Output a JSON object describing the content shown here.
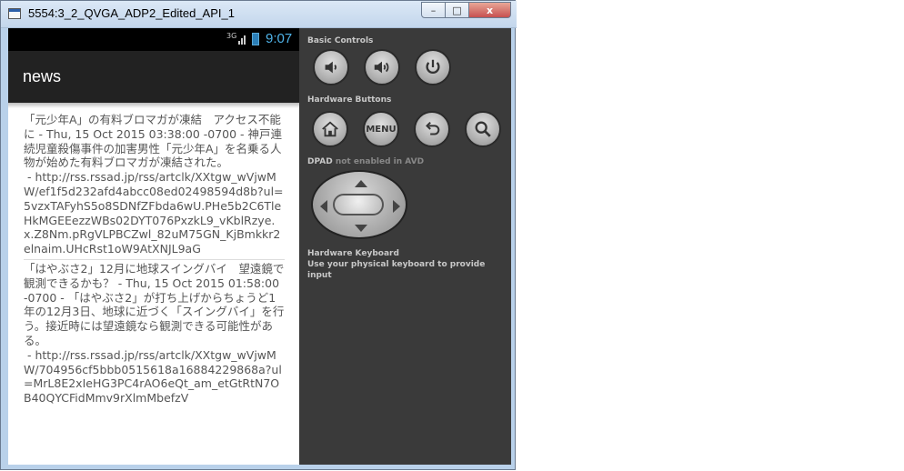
{
  "window": {
    "title": "5554:3_2_QVGA_ADP2_Edited_API_1",
    "minimize": "–",
    "maximize": "□",
    "close": "x"
  },
  "status_bar": {
    "network": "3G",
    "time": "9:07",
    "icons": [
      "signal-icon",
      "battery-icon"
    ]
  },
  "action_bar": {
    "title": "news"
  },
  "news_items": [
    {
      "text": "「元少年A」の有料ブロマガが凍結　アクセス不能に - Thu, 15 Oct 2015 03:38:00 -0700 - 神戸連続児童殺傷事件の加害男性「元少年A」を名乗る人物が始めた有料ブロマガが凍結された。\n - http://rss.rssad.jp/rss/artclk/XXtgw_wVjwMW/ef1f5d232afd4abcc08ed02498594d8b?ul=5vzxTAFyhS5o8SDNfZFbda6wU.PHe5b2C6TleHkMGEEezzWBs02DYT076PxzkL9_vKblRzye.x.Z8Nm.pRgVLPBCZwl_82uM75GN_KjBmkkr2elnaim.UHcRst1oW9AtXNJL9aG"
    },
    {
      "text": "「はやぶさ2」12月に地球スイングバイ　望遠鏡で観測できるかも？ - Thu, 15 Oct 2015 01:58:00 -0700 - 「はやぶさ2」が打ち上げからちょうど1年の12月3日、地球に近づく「スイングバイ」を行う。接近時には望遠鏡なら観測できる可能性がある。\n - http://rss.rssad.jp/rss/artclk/XXtgw_wVjwMW/704956cf5bbb0515618a16884229868a?ul=MrL8E2xIeHG3PC4rAO6eQt_am_etGtRtN7OB40QYCFidMmv9rXlmMbefzV"
    }
  ],
  "controls": {
    "basic_controls_label": "Basic Controls",
    "hardware_buttons_label": "Hardware Buttons",
    "dpad_label": "DPAD",
    "dpad_note": "not enabled in AVD",
    "keyboard_label": "Hardware Keyboard",
    "keyboard_note": "Use your physical keyboard to provide input",
    "menu_label": "MENU"
  }
}
